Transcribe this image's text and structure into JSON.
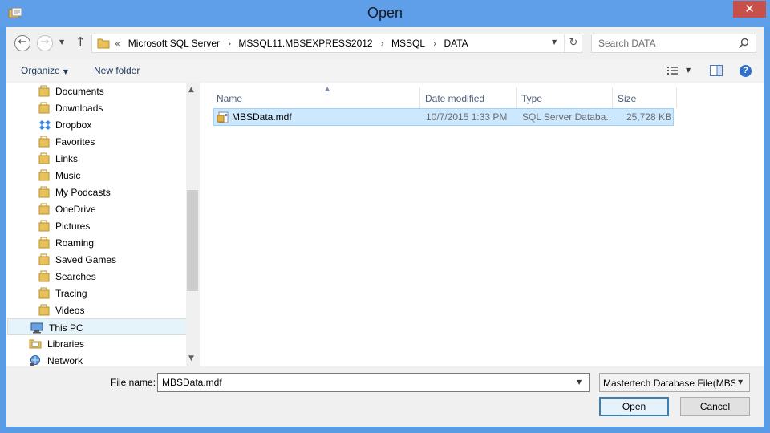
{
  "window": {
    "title": "Open",
    "close_glyph": "✕"
  },
  "address_bar": {
    "overflow_glyph": "«",
    "crumbs": [
      "Microsoft SQL Server",
      "MSSQL11.MBSEXPRESS2012",
      "MSSQL",
      "DATA"
    ],
    "separator_glyph": "›"
  },
  "search": {
    "placeholder": "Search DATA"
  },
  "toolbar": {
    "organize_label": "Organize",
    "new_folder_label": "New folder",
    "help_glyph": "?"
  },
  "nav_pane": {
    "items": [
      {
        "label": "Documents",
        "icon": "documents-folder-icon"
      },
      {
        "label": "Downloads",
        "icon": "downloads-folder-icon"
      },
      {
        "label": "Dropbox",
        "icon": "dropbox-icon"
      },
      {
        "label": "Favorites",
        "icon": "favorites-folder-icon"
      },
      {
        "label": "Links",
        "icon": "links-folder-icon"
      },
      {
        "label": "Music",
        "icon": "music-folder-icon"
      },
      {
        "label": "My Podcasts",
        "icon": "podcasts-folder-icon"
      },
      {
        "label": "OneDrive",
        "icon": "onedrive-folder-icon"
      },
      {
        "label": "Pictures",
        "icon": "pictures-folder-icon"
      },
      {
        "label": "Roaming",
        "icon": "folder-icon"
      },
      {
        "label": "Saved Games",
        "icon": "saved-games-folder-icon"
      },
      {
        "label": "Searches",
        "icon": "searches-folder-icon"
      },
      {
        "label": "Tracing",
        "icon": "folder-icon"
      },
      {
        "label": "Videos",
        "icon": "videos-folder-icon"
      },
      {
        "label": "This PC",
        "icon": "this-pc-icon"
      },
      {
        "label": "Libraries",
        "icon": "libraries-icon"
      },
      {
        "label": "Network",
        "icon": "network-icon"
      }
    ]
  },
  "file_list": {
    "columns": [
      "Name",
      "Date modified",
      "Type",
      "Size"
    ],
    "rows": [
      {
        "name": "MBSData.mdf",
        "date_modified": "10/7/2015 1:33 PM",
        "type": "SQL Server Databa...",
        "size": "25,728 KB"
      }
    ]
  },
  "bottom": {
    "file_name_label": "File name:",
    "file_name_value": "MBSData.mdf",
    "filter_value": "Mastertech Database File(MBSD",
    "open_label_underlined": "O",
    "open_label_rest": "pen",
    "cancel_label": "Cancel"
  },
  "colors": {
    "title_bar": "#5f9ee9",
    "selection": "#cce8ff",
    "close_button": "#c7504a"
  }
}
